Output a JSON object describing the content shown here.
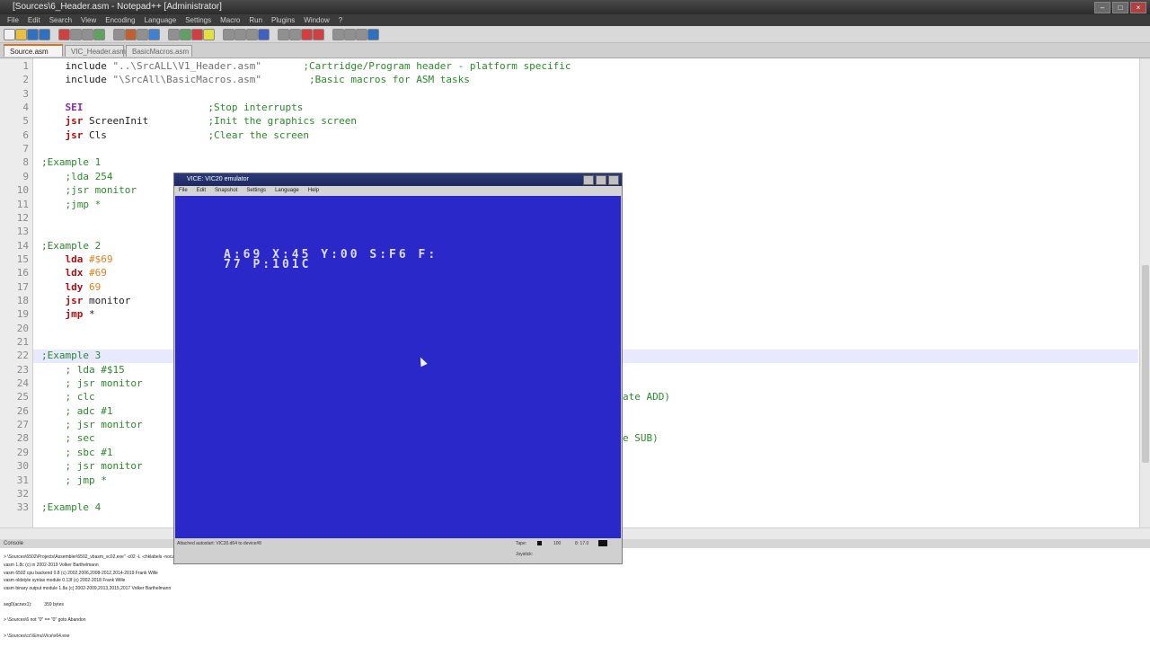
{
  "window": {
    "title": "[Sources\\6_Header.asm - Notepad++ [Administrator]"
  },
  "menubar": [
    "File",
    "Edit",
    "Search",
    "View",
    "Encoding",
    "Language",
    "Settings",
    "Macro",
    "Run",
    "Plugins",
    "Window",
    "?"
  ],
  "tabs": [
    {
      "label": "Source.asm",
      "active": true
    },
    {
      "label": "VIC_Header.asm",
      "active": false
    },
    {
      "label": "BasicMacros.asm",
      "active": false
    }
  ],
  "editor": {
    "line_numbers": [
      "1",
      "2",
      "3",
      "4",
      "5",
      "6",
      "7",
      "8",
      "9",
      "10",
      "11",
      "12",
      "13",
      "14",
      "15",
      "16",
      "17",
      "18",
      "19",
      "20",
      "21",
      "22",
      "23",
      "24",
      "25",
      "26",
      "27",
      "28",
      "29",
      "30",
      "31",
      "32",
      "33"
    ],
    "highlight_line": 22,
    "lines": [
      {
        "n": "1",
        "a": "    include ",
        "s": "\"..\\SrcALL\\V1_Header.asm\"",
        "c": "       ;Cartridge/Program header - platform specific"
      },
      {
        "n": "2",
        "a": "    include ",
        "s": "\"\\SrcAll\\BasicMacros.asm\"",
        "c": "        ;Basic macros for ASM tasks"
      },
      {
        "n": "3"
      },
      {
        "n": "4",
        "sei": "SEI",
        "c": "                     ;Stop interrupts"
      },
      {
        "n": "5",
        "k": "jsr",
        "r": " ScreenInit",
        "c": "          ;Init the graphics screen"
      },
      {
        "n": "6",
        "k": "jsr",
        "r": " Cls",
        "c": "                 ;Clear the screen"
      },
      {
        "n": "7"
      },
      {
        "n": "8",
        "lbl": ";Example 1"
      },
      {
        "n": "9",
        "lbl": "    ;lda 254"
      },
      {
        "n": "10",
        "lbl": "    ;jsr monitor"
      },
      {
        "n": "11",
        "lbl": "    ;jmp *"
      },
      {
        "n": "12"
      },
      {
        "n": "13"
      },
      {
        "n": "14",
        "lbl": ";Example 2"
      },
      {
        "n": "15",
        "k": "lda",
        "r": " ",
        "num": "#$69"
      },
      {
        "n": "16",
        "k": "ldx",
        "r": " ",
        "num": "#69"
      },
      {
        "n": "17",
        "k": "ldy",
        "r": " ",
        "num": "69"
      },
      {
        "n": "18",
        "k": "jsr",
        "r": " monitor"
      },
      {
        "n": "19",
        "k": "jmp",
        "r": " *"
      },
      {
        "n": "20"
      },
      {
        "n": "21"
      },
      {
        "n": "22",
        "lbl": ";Example 3"
      },
      {
        "n": "23",
        "lbl": "    ; lda #$15"
      },
      {
        "n": "24",
        "lbl": "    ; jsr monitor"
      },
      {
        "n": "25",
        "lbl": "    ; clc",
        "tail": "ate ADD)"
      },
      {
        "n": "26",
        "lbl": "    ; adc #1"
      },
      {
        "n": "27",
        "lbl": "    ; jsr monitor"
      },
      {
        "n": "28",
        "lbl": "    ; sec",
        "tail": "e SUB)"
      },
      {
        "n": "29",
        "lbl": "    ; sbc #1"
      },
      {
        "n": "30",
        "lbl": "    ; jsr monitor"
      },
      {
        "n": "31",
        "lbl": "    ; jmp *"
      },
      {
        "n": "32"
      },
      {
        "n": "33",
        "lbl": ";Example 4"
      }
    ]
  },
  "console": {
    "header": "Console",
    "lines": [
      "> \\Sources\\6502\\Projects\\Assembler\\6502_vbasm_vc02.exe\" -c02 -L -chklabels -nocase -Dvasm=1 -Fbin",
      "vasm 1.8c (c) in 2002-2019 Volker Barthelmann",
      "vasm 6502 cpu backend 0.8 (c) 2002,2006,2008-2012,2014-2019 Frank Wille",
      "vasm oldstyle syntax module 0.13f (c) 2002-2018 Frank Wille",
      "vasm binary output module 1.8a (c) 2002-2009,2013,2015,2017 Volker Barthelmann",
      "",
      "seg0(acrwx1):          359 bytes",
      "",
      "> \\Sources\\6 not \"0\" == \"0\" goto Abandon",
      "",
      "> \\Sources\\cc\\\\Emu\\Vice\\x64.exe"
    ]
  },
  "emulator": {
    "title": "VICE: VIC20 emulator",
    "menu": [
      "File",
      "Edit",
      "Snapshot",
      "Settings",
      "Language",
      "Help"
    ],
    "screen_lines": [
      "A:69 X:45 Y:00 S:F6 F:",
      "77 P:101C"
    ],
    "status_left": "Attached autostart: VIC20.d64 to device#8",
    "status_tape": "Tape:",
    "status_speed": "100",
    "status_pos": "8: 17.0",
    "status_joystick": "Joystick:"
  }
}
